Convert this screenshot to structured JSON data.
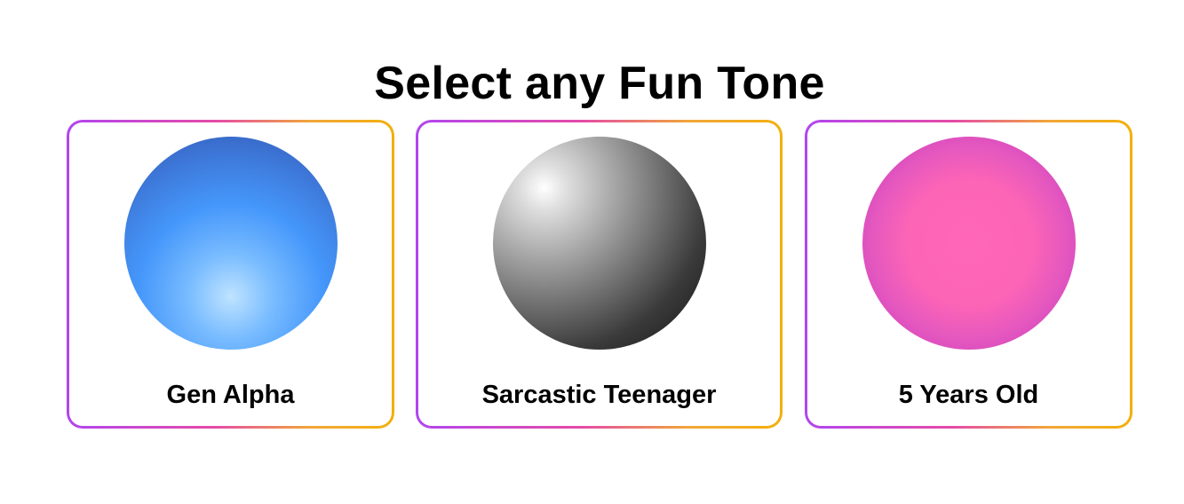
{
  "header": {
    "title": "Select any Fun Tone"
  },
  "tones": [
    {
      "label": "Gen Alpha",
      "icon": "blue-orb-icon",
      "accent": "#4597fb"
    },
    {
      "label": "Sarcastic Teenager",
      "icon": "gray-orb-icon",
      "accent": "#6e6e6e"
    },
    {
      "label": "5 Years Old",
      "icon": "pink-orb-icon",
      "accent": "#fc64b6"
    }
  ],
  "colors": {
    "border_gradient": [
      "#b046f0",
      "#e54aa8",
      "#f0a838",
      "#f2b00c"
    ],
    "background": "#ffffff",
    "text": "#000000"
  }
}
